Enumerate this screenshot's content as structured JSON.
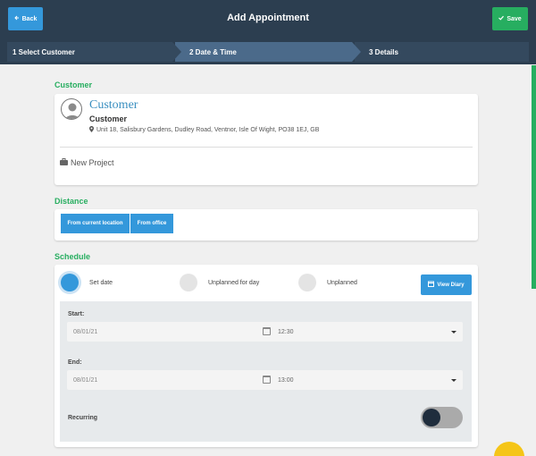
{
  "header": {
    "back_label": "Back",
    "title": "Add Appointment",
    "save_label": "Save"
  },
  "steps": [
    {
      "label": "1 Select Customer"
    },
    {
      "label": "2 Date & Time"
    },
    {
      "label": "3 Details"
    }
  ],
  "customer": {
    "section_title": "Customer",
    "display_name": "Customer",
    "name": "Customer",
    "address": "Unit 18, Salisbury Gardens, Dudley Road, Ventnor, Isle Of Wight, PO38 1EJ, GB",
    "project_label": "New Project"
  },
  "distance": {
    "section_title": "Distance",
    "from_current_label": "From current location",
    "from_office_label": "From office"
  },
  "schedule": {
    "section_title": "Schedule",
    "options": [
      {
        "label": "Set date",
        "checked": true
      },
      {
        "label": "Unplanned for day",
        "checked": false
      },
      {
        "label": "Unplanned",
        "checked": false
      }
    ],
    "view_diary_label": "View Diary",
    "start": {
      "label": "Start:",
      "date": "08/01/21",
      "time": "12:30"
    },
    "end": {
      "label": "End:",
      "date": "08/01/21",
      "time": "13:00"
    },
    "recurring_label": "Recurring",
    "recurring_on": false
  },
  "colors": {
    "header_bg": "#2c3e50",
    "accent_blue": "#3498db",
    "accent_green": "#27ae60",
    "fab_yellow": "#f5c518"
  }
}
